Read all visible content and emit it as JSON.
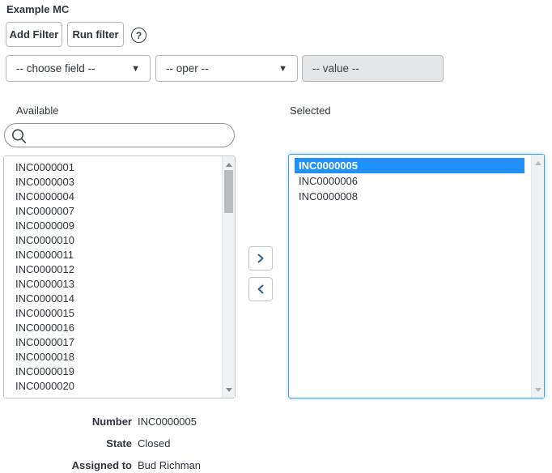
{
  "title": "Example MC",
  "toolbar": {
    "add_filter_label": "Add Filter",
    "run_filter_label": "Run filter",
    "help_label": "?"
  },
  "filter": {
    "field_dropdown_value": "-- choose field --",
    "oper_dropdown_value": "-- oper --",
    "value_placeholder": "-- value --"
  },
  "slushbucket": {
    "available_label": "Available",
    "selected_label": "Selected",
    "search_value": "",
    "search_placeholder": "",
    "available_items": [
      "INC0000001",
      "INC0000003",
      "INC0000004",
      "INC0000007",
      "INC0000009",
      "INC0000010",
      "INC0000011",
      "INC0000012",
      "INC0000013",
      "INC0000014",
      "INC0000015",
      "INC0000016",
      "INC0000017",
      "INC0000018",
      "INC0000019",
      "INC0000020"
    ],
    "selected_items": [
      "INC0000005",
      "INC0000006",
      "INC0000008"
    ],
    "highlighted_item": "INC0000005"
  },
  "details": {
    "rows": [
      {
        "label": "Number",
        "value": "INC0000005"
      },
      {
        "label": "State",
        "value": "Closed"
      },
      {
        "label": "Assigned to",
        "value": "Bud Richman"
      }
    ]
  },
  "colors": {
    "highlight_blue": "#2191fa",
    "focus_border_blue": "#42a0f5",
    "text": "#2e343d",
    "disabled_input_bg": "#e4e5e7"
  }
}
